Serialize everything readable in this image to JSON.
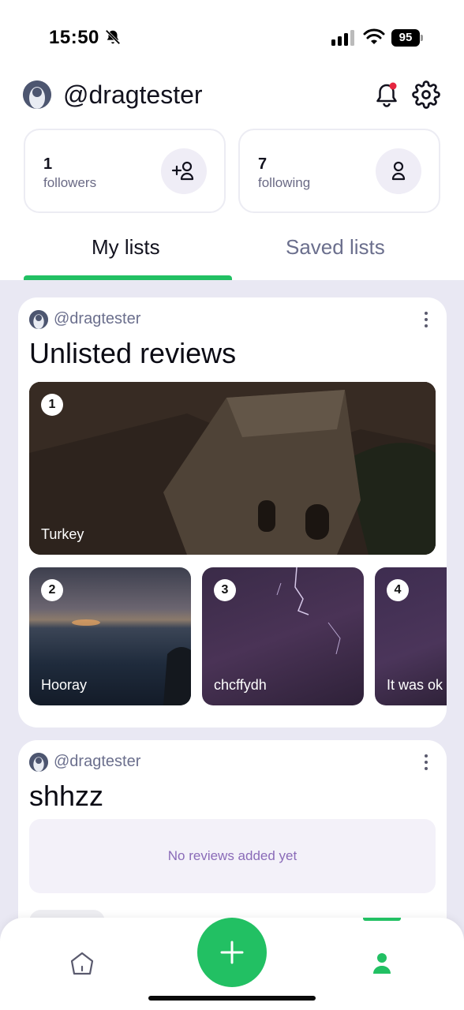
{
  "status_bar": {
    "time": "15:50",
    "battery": "95"
  },
  "header": {
    "username": "@dragtester"
  },
  "stats": {
    "followers": {
      "count": "1",
      "label": "followers"
    },
    "following": {
      "count": "7",
      "label": "following"
    }
  },
  "tabs": [
    {
      "label": "My lists",
      "active": true
    },
    {
      "label": "Saved lists",
      "active": false
    }
  ],
  "lists": [
    {
      "owner": "@dragtester",
      "title": "Unlisted reviews",
      "reviews": [
        {
          "rank": "1",
          "label": "Turkey"
        },
        {
          "rank": "2",
          "label": "Hooray"
        },
        {
          "rank": "3",
          "label": "chcffydh"
        },
        {
          "rank": "4",
          "label": "It was ok"
        }
      ]
    },
    {
      "owner": "@dragtester",
      "title": "shhzz",
      "empty_text": "No reviews added yet"
    }
  ],
  "colors": {
    "accent": "#22c063",
    "notification_dot": "#e5253f",
    "background": "#e9e8f3"
  },
  "icons": {
    "notification": "bell-icon",
    "settings": "gear-icon",
    "add_follower": "user-plus-icon",
    "following": "user-icon",
    "home": "home-icon",
    "add": "plus-icon",
    "profile": "profile-icon"
  }
}
